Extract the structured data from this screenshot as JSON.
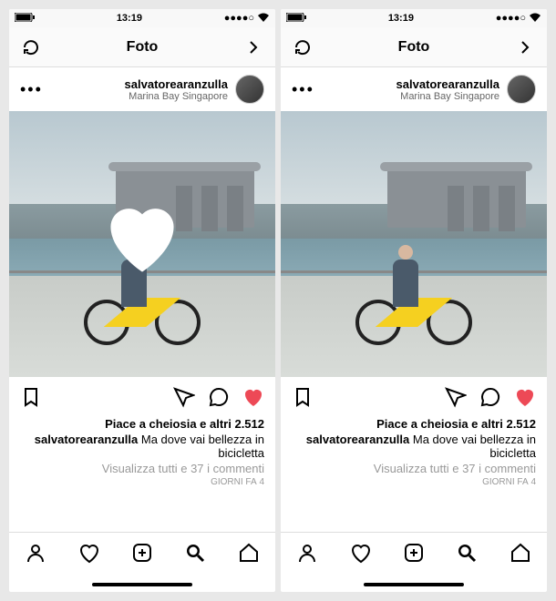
{
  "status": {
    "time": "13:19",
    "carrier_signal": "●●●●○",
    "wifi": "wifi-icon",
    "battery": "battery-icon"
  },
  "nav": {
    "title": "Foto",
    "back": "back-icon",
    "refresh": "refresh-icon"
  },
  "post": {
    "username": "salvatorearanzulla",
    "location": "Marina Bay Singapore",
    "likes_text": "Piace a cheiosia e altri 2.512",
    "caption_user": "salvatorearanzulla",
    "caption_text": " Ma dove vai bellezza in bicicletta",
    "view_comments": "Visualizza tutti e 37 i commenti",
    "time_ago": "4 GIORNI FA"
  },
  "colors": {
    "like_active": "#ed4956",
    "bike_yellow": "#f5d020"
  },
  "screens": [
    {
      "show_heart_animation": true
    },
    {
      "show_heart_animation": false
    }
  ]
}
